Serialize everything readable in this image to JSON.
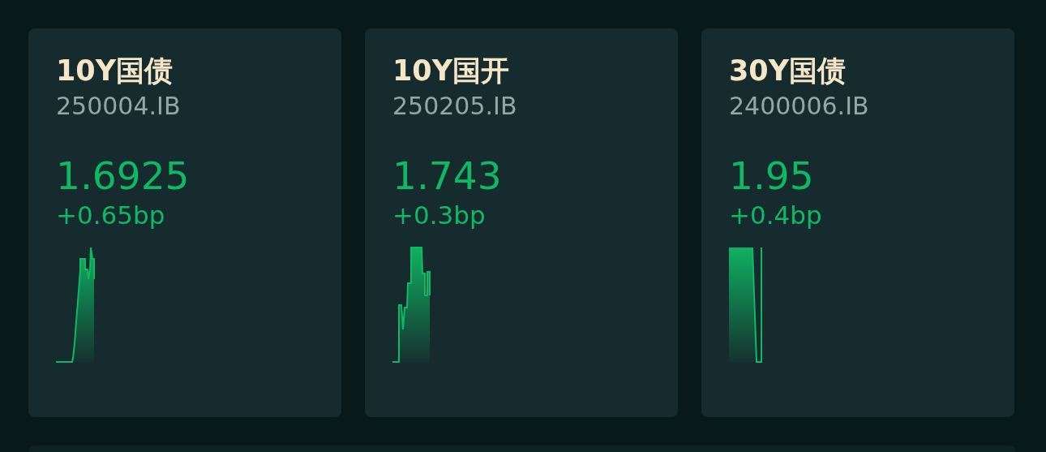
{
  "cards": [
    {
      "name": "10Y国债",
      "code": "250004.IB",
      "value": "1.6925",
      "change": "+0.65bp"
    },
    {
      "name": "10Y国开",
      "code": "250205.IB",
      "value": "1.743",
      "change": "+0.3bp"
    },
    {
      "name": "30Y国债",
      "code": "2400006.IB",
      "value": "1.95",
      "change": "+0.4bp"
    }
  ]
}
